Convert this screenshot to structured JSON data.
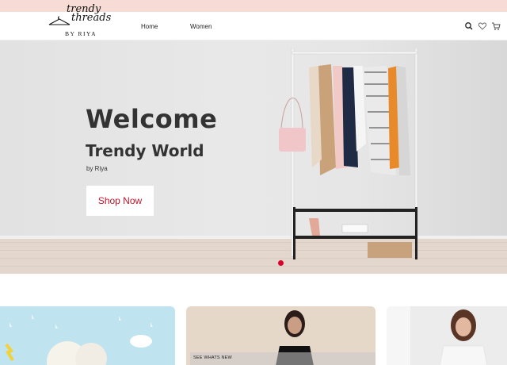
{
  "brand": {
    "logo_line1": "trendy",
    "logo_line2": "threads",
    "logo_by": "BY RIYA"
  },
  "nav": {
    "home": "Home",
    "women": "Women"
  },
  "header_icons": [
    "search-icon",
    "heart-icon",
    "cart-icon"
  ],
  "hero": {
    "title": "Welcome",
    "subtitle": "Trendy World",
    "by": "by Riya",
    "cta": "Shop Now",
    "cta_color": "#c0142b",
    "active_dot_color": "#d9002a"
  },
  "cards": {
    "ribbon": "SEE WHATS NEW"
  },
  "colors": {
    "topbar": "#f7dcd5"
  }
}
